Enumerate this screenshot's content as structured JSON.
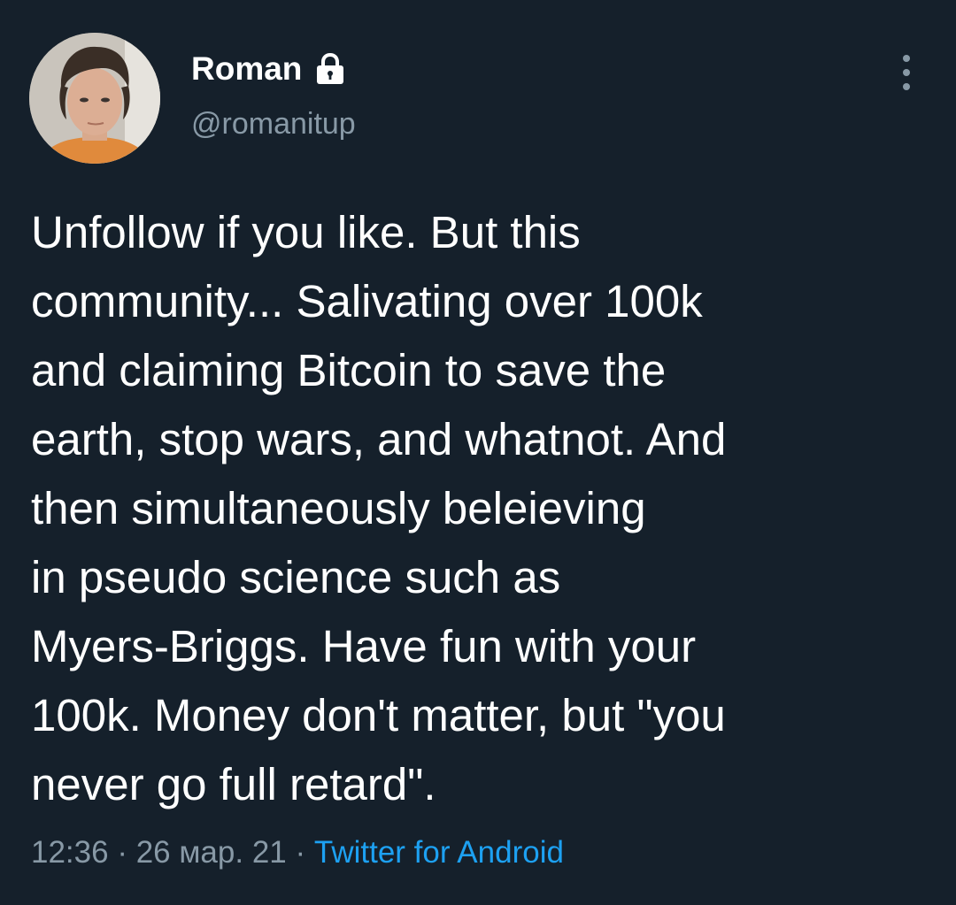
{
  "author": {
    "display_name": "Roman",
    "handle": "@romanitup",
    "protected_icon": "lock-icon",
    "avatar_icon": "profile-photo"
  },
  "menu": {
    "icon": "more-vertical-icon"
  },
  "tweet": {
    "text_lines": [
      "Unfollow if you like. But this",
      "community... Salivating over 100k",
      "and claiming Bitcoin to save the",
      "earth, stop wars, and whatnot. And",
      "then simultaneously beleieving",
      "in pseudo science such as",
      "Myers-Briggs. Have fun with your",
      "100k. Money don't matter, but \"you",
      "never go full retard\"."
    ],
    "time": "12:36",
    "separator": "·",
    "date": "26 мар. 21",
    "source": "Twitter for Android"
  },
  "colors": {
    "background": "#15202b",
    "text_primary": "#ffffff",
    "text_secondary": "#8899a6",
    "link": "#1da1f2"
  }
}
